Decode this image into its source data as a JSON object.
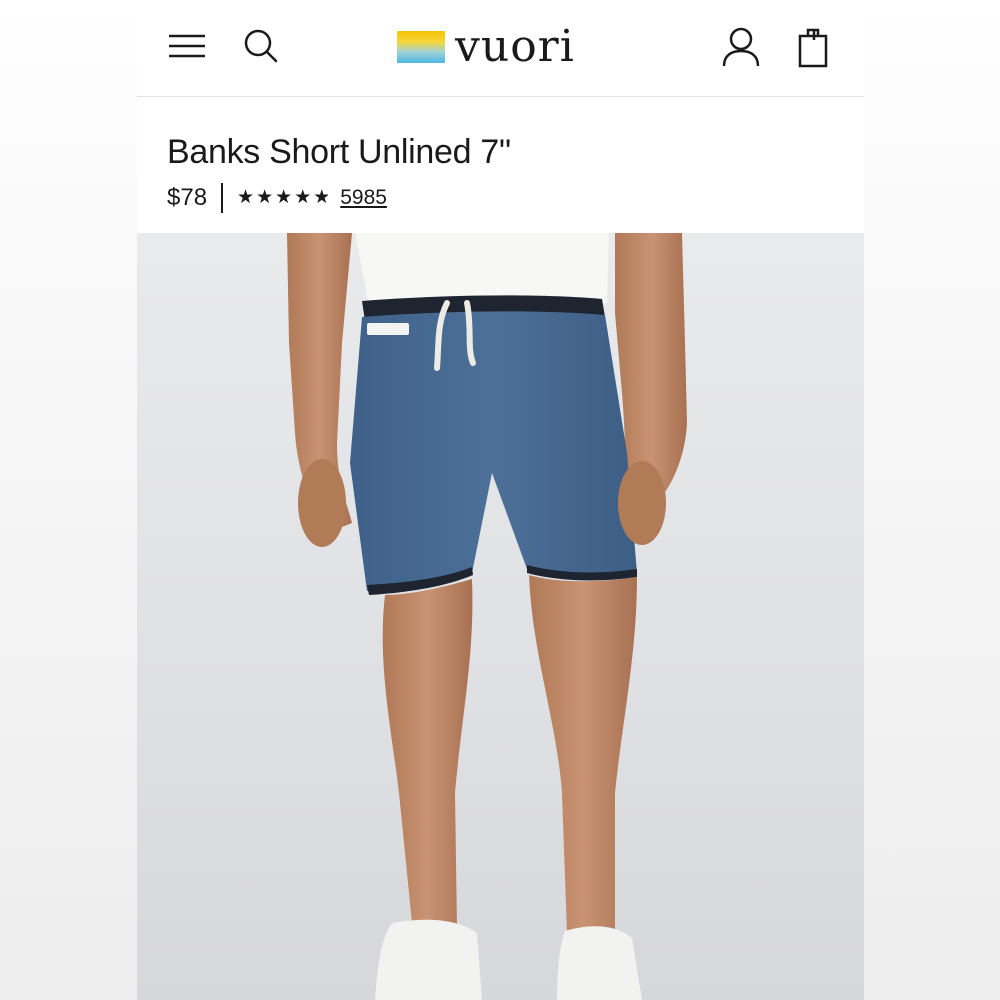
{
  "brand": {
    "name": "vuori",
    "logo_colors": [
      "#f5c400",
      "#4fb6e5"
    ]
  },
  "header": {
    "icons": [
      "menu-icon",
      "search-icon",
      "account-icon",
      "bag-icon"
    ]
  },
  "product": {
    "title": "Banks Short Unlined 7\"",
    "price": "$78",
    "rating": 4.5,
    "review_count": "5985"
  },
  "photo": {
    "subject": "product-photo",
    "shorts_color": "#4a6c94",
    "background_color": "#e3e4e7"
  }
}
